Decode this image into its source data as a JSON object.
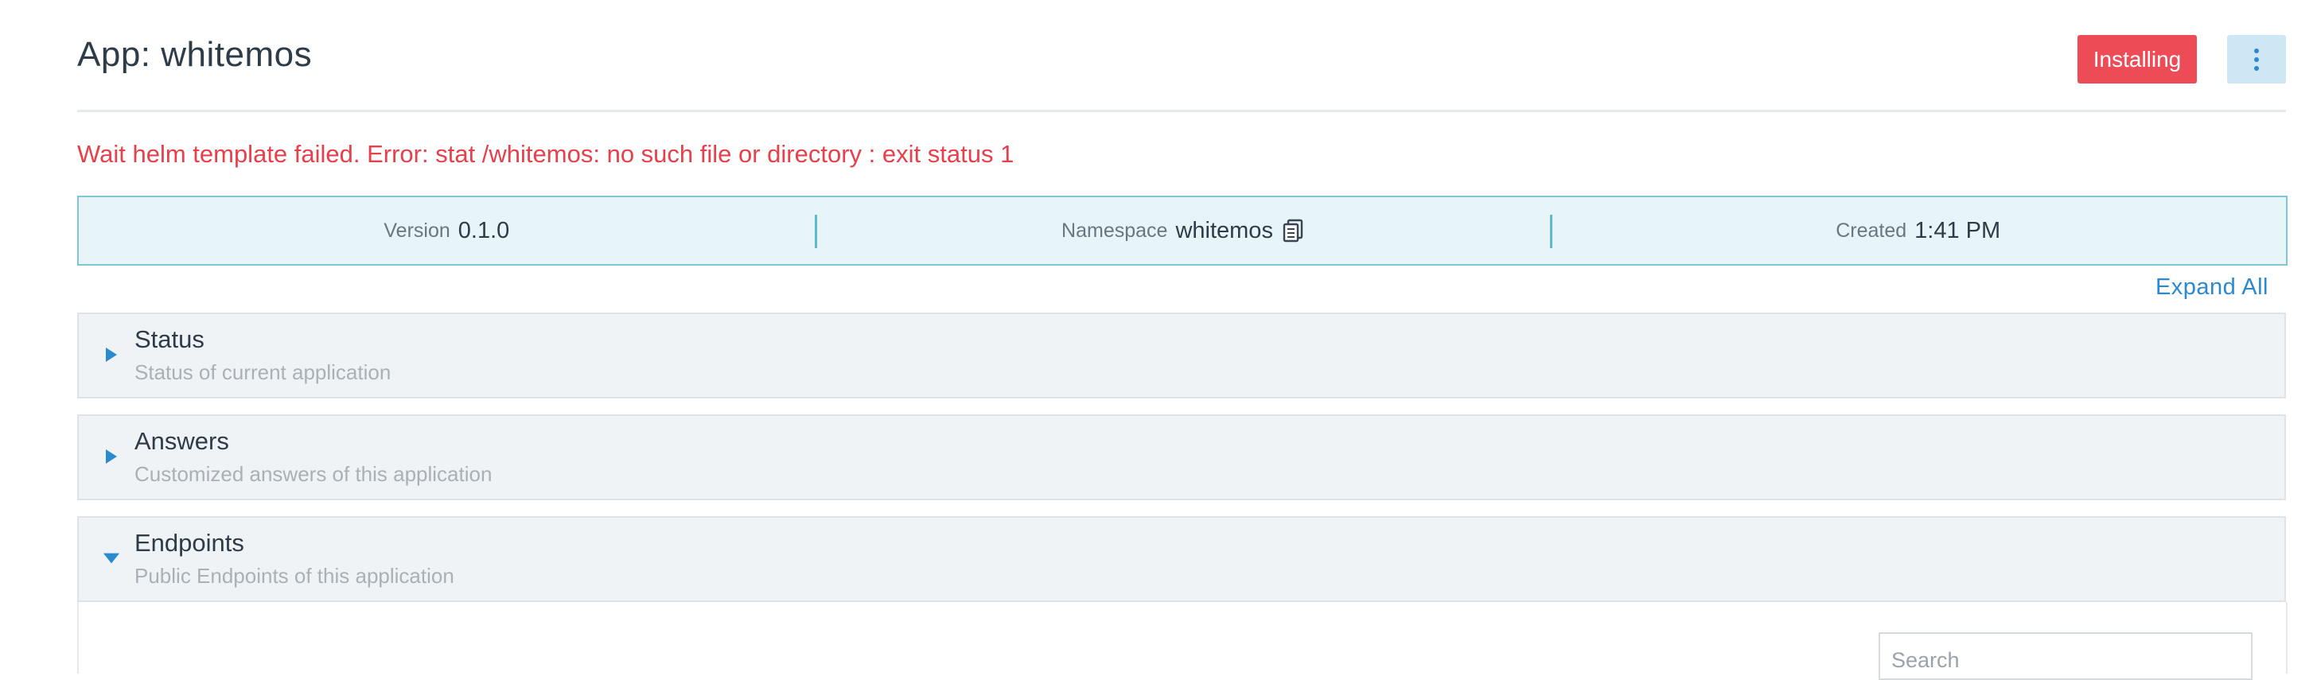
{
  "header": {
    "title": "App: whitemos",
    "state": "Installing",
    "more_icon": "kebab-vertical-icon"
  },
  "error_message": "Wait helm template failed. Error: stat /whitemos: no such file or directory : exit status 1",
  "info": {
    "version_label": "Version",
    "version_value": "0.1.0",
    "namespace_label": "Namespace",
    "namespace_value": "whitemos",
    "copy_icon": "clipboard-icon",
    "created_label": "Created",
    "created_value": "1:41 PM"
  },
  "expand_all_label": "Expand All",
  "sections": [
    {
      "title": "Status",
      "description": "Status of current application",
      "expanded": false
    },
    {
      "title": "Answers",
      "description": "Customized answers of this application",
      "expanded": false
    },
    {
      "title": "Endpoints",
      "description": "Public Endpoints of this application",
      "expanded": true
    }
  ],
  "search": {
    "placeholder": "Search",
    "value": ""
  },
  "colors": {
    "accent": "#2b89d0",
    "error": "#e8404b",
    "badge": "#ed4c56",
    "info_bar_bg": "#e7f4f8",
    "info_bar_border": "#7fc6d6"
  }
}
